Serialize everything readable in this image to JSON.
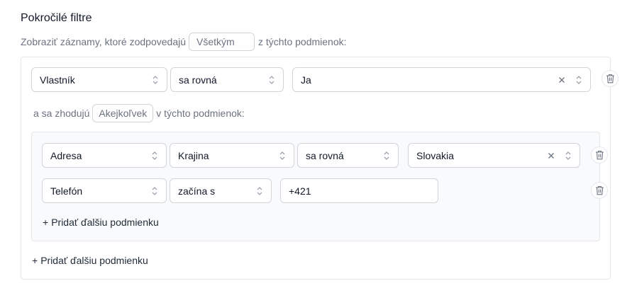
{
  "header": {
    "title": "Pokročilé filtre"
  },
  "intro": {
    "prefix": "Zobraziť záznamy, ktoré zodpovedajú",
    "match_mode": "Všetkým",
    "suffix": "z týchto podmienok:"
  },
  "rule1": {
    "field": "Vlastník",
    "operator": "sa rovná",
    "value": "Ja"
  },
  "group": {
    "prefix": "a sa zhodujú",
    "match_mode": "Akejkoľvek",
    "suffix": "v týchto podmienok:",
    "rules": [
      {
        "field": "Adresa",
        "subfield": "Krajina",
        "operator": "sa rovná",
        "value": "Slovakia"
      },
      {
        "field": "Telefón",
        "operator": "začína s",
        "value": "+421"
      }
    ],
    "add_label": "Pridať ďalšiu podmienku"
  },
  "footer": {
    "add_label": "Pridať ďalšiu podmienku"
  },
  "icons": {
    "plus": "+",
    "chevron": "chevron-up-down-icon",
    "clear": "x-icon",
    "trash": "trash-icon"
  },
  "colors": {
    "border": "#d1d5db",
    "panel_border": "#e5e7eb",
    "muted_text": "#6b7280",
    "inner_bg": "#f9fafb"
  }
}
